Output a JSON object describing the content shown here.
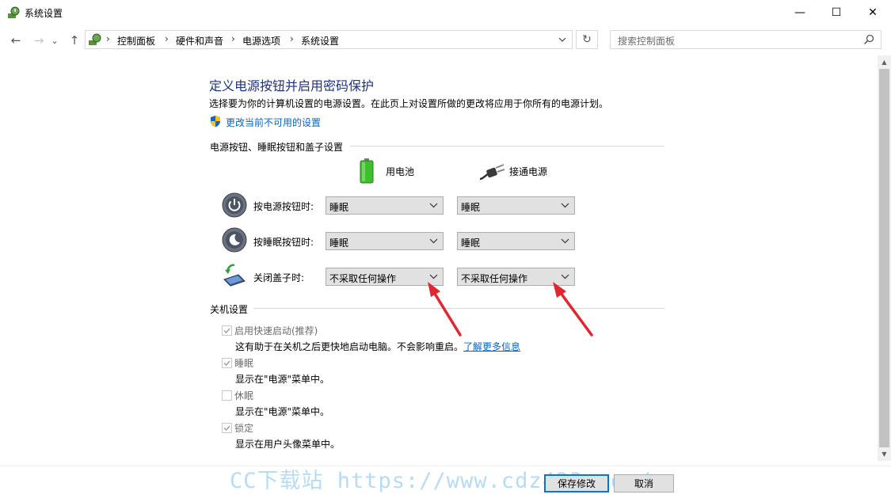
{
  "window": {
    "title": "系统设置",
    "minimize_glyph": "—",
    "maximize_glyph": "☐",
    "close_glyph": "✕"
  },
  "nav": {
    "back_glyph": "←",
    "forward_glyph": "→",
    "recent_glyph": "⌄",
    "up_glyph": "↑",
    "breadcrumbs": [
      "控制面板",
      "硬件和声音",
      "电源选项",
      "系统设置"
    ],
    "separator": "›",
    "refresh_glyph": "↻",
    "search_placeholder": "搜索控制面板"
  },
  "content": {
    "title": "定义电源按钮并启用密码保护",
    "description": "选择要为你的计算机设置的电源设置。在此页上对设置所做的更改将应用于你所有的电源计划。",
    "change_link": "更改当前不可用的设置",
    "section_buttons": "电源按钮、睡眠按钮和盖子设置",
    "battery_label": "用电池",
    "plugged_label": "接通电源",
    "rows": [
      {
        "label": "按电源按钮时:",
        "battery": "睡眠",
        "plugged": "睡眠"
      },
      {
        "label": "按睡眠按钮时:",
        "battery": "睡眠",
        "plugged": "睡眠"
      },
      {
        "label": "关闭盖子时:",
        "battery": "不采取任何操作",
        "plugged": "不采取任何操作"
      }
    ],
    "section_shutdown": "关机设置",
    "shutdown_options": [
      {
        "label": "启用快速启动(推荐)",
        "desc": "这有助于在关机之后更快地启动电脑。不会影响重启。",
        "link": "了解更多信息",
        "checked": true
      },
      {
        "label": "睡眠",
        "desc": "显示在\"电源\"菜单中。",
        "checked": true
      },
      {
        "label": "休眠",
        "desc": "显示在\"电源\"菜单中。",
        "checked": false
      },
      {
        "label": "锁定",
        "desc": "显示在用户头像菜单中。",
        "checked": true
      }
    ]
  },
  "buttons": {
    "save": "保存修改",
    "cancel": "取消"
  },
  "watermark": "CC下载站 https://www.cdz423.com/",
  "colors": {
    "accent": "#0078d7",
    "link": "#0066cc",
    "title": "#1e3287",
    "arrow": "#e0262e"
  }
}
